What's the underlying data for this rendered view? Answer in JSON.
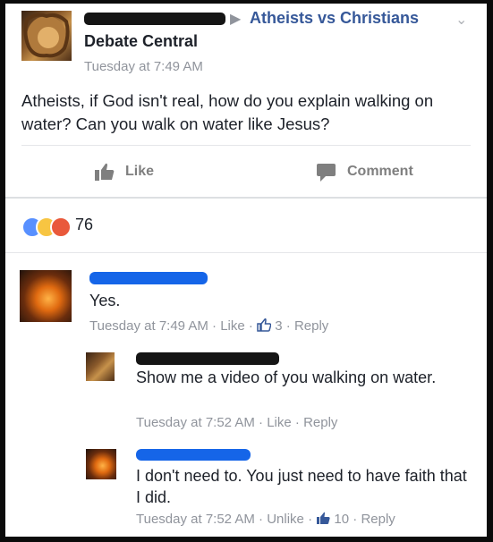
{
  "post": {
    "group": "Atheists vs Christians",
    "group_line2": "Debate Central",
    "timestamp": "Tuesday at 7:49 AM",
    "body": "Atheists, if God isn't real, how do you explain walking on water? Can you walk on water like Jesus?"
  },
  "actions": {
    "like": "Like",
    "comment": "Comment"
  },
  "reactions": {
    "count": "76"
  },
  "comments": [
    {
      "text": "Yes.",
      "time": "Tuesday at 7:49 AM",
      "action": "Like",
      "likes": "3",
      "reply": "Reply"
    },
    {
      "text": "Show me a video of you walking on water.",
      "time": "Tuesday at 7:52 AM",
      "action": "Like",
      "reply": "Reply"
    },
    {
      "text": "I don't need to. You just need to have faith that I did.",
      "time": "Tuesday at 7:52 AM",
      "action": "Unlike",
      "likes": "10",
      "reply": "Reply"
    }
  ],
  "separators": {
    "dot": "·"
  },
  "colors": {
    "link": "#365899",
    "meta": "#90949c",
    "text": "#1d2129",
    "redact_blue": "#1565e8"
  }
}
